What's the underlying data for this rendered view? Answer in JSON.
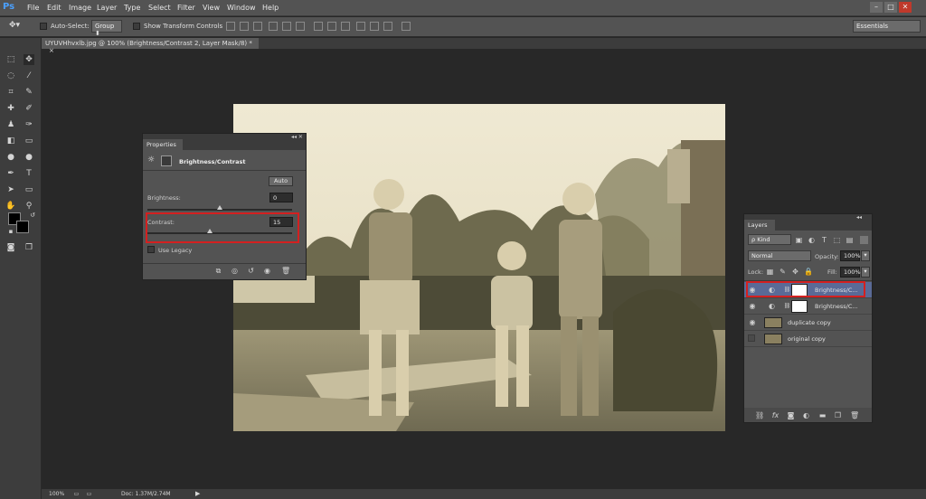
{
  "app": {
    "logo": "Ps"
  },
  "menu": [
    "File",
    "Edit",
    "Image",
    "Layer",
    "Type",
    "Select",
    "Filter",
    "View",
    "Window",
    "Help"
  ],
  "window_controls": [
    "–",
    "□",
    "✕"
  ],
  "options_bar": {
    "auto_select_label": "Auto-Select:",
    "auto_select_value": "Group",
    "show_transform_label": "Show Transform Controls",
    "workspace": "Essentials"
  },
  "document_tab": {
    "title": "UYUVHhvxlb.jpg @ 100% (Brightness/Contrast 2, Layer Mask/8) *",
    "close": "×"
  },
  "properties": {
    "panel_title": "Properties",
    "adjustment_title": "Brightness/Contrast",
    "auto_label": "Auto",
    "brightness_label": "Brightness:",
    "brightness_value": "0",
    "brightness_level": 0,
    "contrast_label": "Contrast:",
    "contrast_value": "15",
    "contrast_level": 15,
    "use_legacy_label": "Use Legacy"
  },
  "layers": {
    "panel_title": "Layers",
    "kind_label": "ρ Kind",
    "blend_mode": "Normal",
    "opacity_label": "Opacity:",
    "opacity_value": "100%",
    "lock_label": "Lock:",
    "fill_label": "Fill:",
    "fill_value": "100%",
    "rows": [
      {
        "name": "Brightness/C...",
        "type": "adjustment",
        "visible": true,
        "selected": true
      },
      {
        "name": "Brightness/C...",
        "type": "adjustment",
        "visible": true,
        "selected": false
      },
      {
        "name": "duplicate copy",
        "type": "image",
        "visible": true,
        "selected": false
      },
      {
        "name": "original copy",
        "type": "image",
        "visible": false,
        "selected": false
      }
    ]
  },
  "status": {
    "zoom": "100%",
    "doc": "Doc: 1.37M/2.74M"
  },
  "colors": {
    "accent_red": "#d42020",
    "selected_layer": "#5a6a96"
  }
}
